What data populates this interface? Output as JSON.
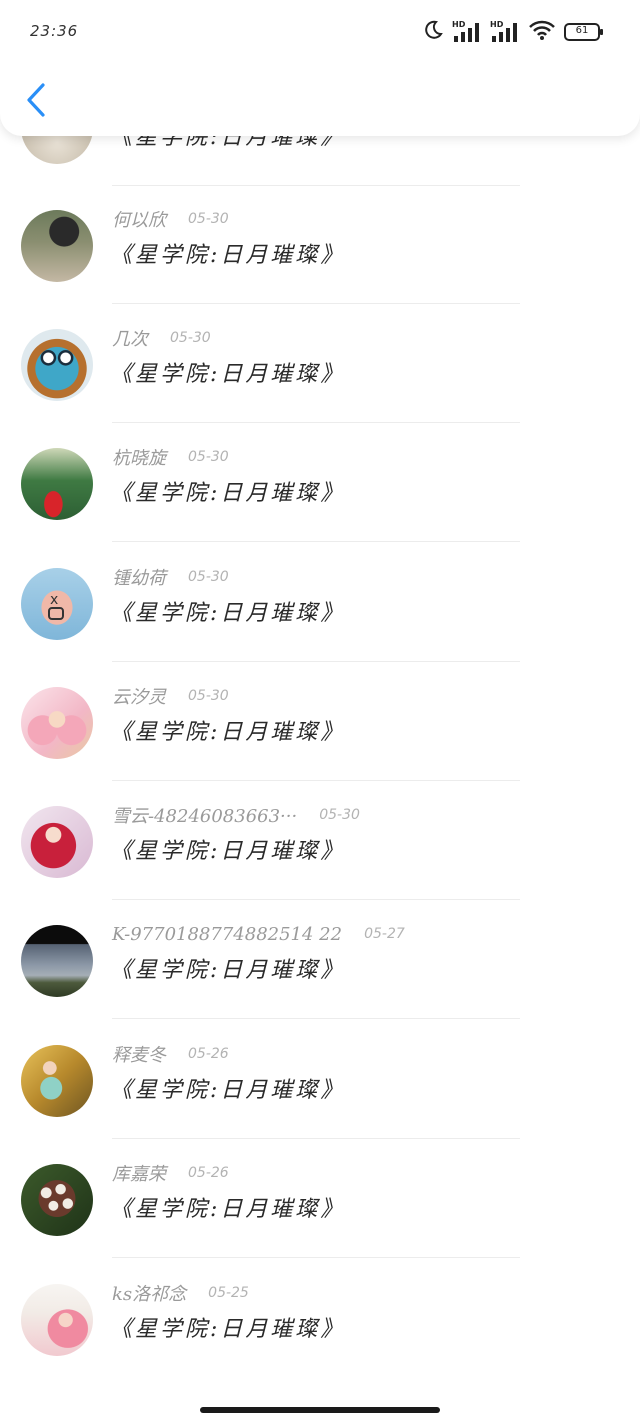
{
  "status_bar": {
    "time": "23:36",
    "icons": [
      "moon-icon",
      "signal-hd-icon",
      "signal-hd-icon",
      "wifi-icon",
      "battery-icon"
    ],
    "hd_label": "HD",
    "battery_level": "61"
  },
  "header": {
    "back_icon": "chevron-left-icon",
    "accent_color": "#2a8ff7"
  },
  "messages": [
    {
      "name": "",
      "date": "",
      "text": "《星学院:日月璀璨》",
      "avatar": "partial-avatar"
    },
    {
      "name": "何以欣",
      "date": "05-30",
      "text": "《星学院:日月璀璨》",
      "avatar": "girl-photo-avatar"
    },
    {
      "name": "几次",
      "date": "05-30",
      "text": "《星学院:日月璀璨》",
      "avatar": "owl-avatar"
    },
    {
      "name": "杭晓旋",
      "date": "05-30",
      "text": "《星学院:日月璀璨》",
      "avatar": "graduation-avatar"
    },
    {
      "name": "锺幼荷",
      "date": "05-30",
      "text": "《星学院:日月璀璨》",
      "avatar": "finger-face-avatar"
    },
    {
      "name": "云汐灵",
      "date": "05-30",
      "text": "《星学院:日月璀璨》",
      "avatar": "anime-pink-avatar"
    },
    {
      "name": "雪云-48246083663···",
      "date": "05-30",
      "text": "《星学院:日月璀璨》",
      "avatar": "anime-red-avatar"
    },
    {
      "name": "K-9770188774882514 22",
      "date": "05-27",
      "text": "《星学院:日月璀璨》",
      "avatar": "sky-landscape-avatar"
    },
    {
      "name": "释麦冬",
      "date": "05-26",
      "text": "《星学院:日月璀璨》",
      "avatar": "girl-bicycle-avatar"
    },
    {
      "name": "库嘉荣",
      "date": "05-26",
      "text": "《星学院:日月璀璨》",
      "avatar": "flower-avatar"
    },
    {
      "name": "ks洛祁念",
      "date": "05-25",
      "text": "《星学院:日月璀璨》",
      "avatar": "anime-calendar-avatar"
    }
  ]
}
